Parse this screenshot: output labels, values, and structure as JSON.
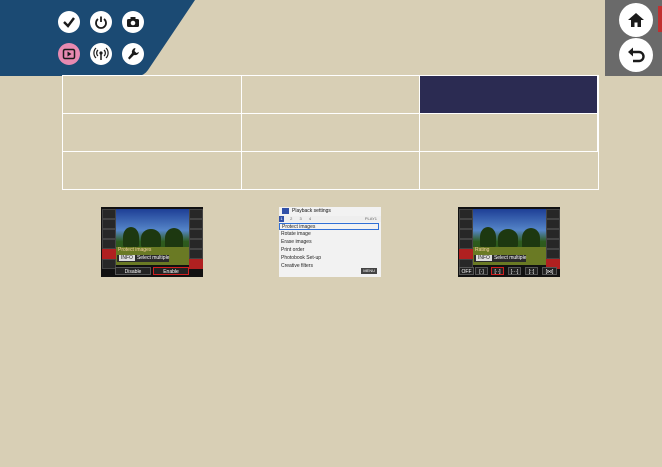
{
  "header": {
    "colors": {
      "band": "#1b4a73",
      "accent": "#e88ab1",
      "background": "#d8cfb5"
    },
    "left_icons": [
      {
        "name": "checkmark-icon",
        "active": false
      },
      {
        "name": "power-icon",
        "active": false
      },
      {
        "name": "camera-icon",
        "active": false
      },
      {
        "name": "playback-icon",
        "active": true
      },
      {
        "name": "wireless-icon",
        "active": false
      },
      {
        "name": "wrench-icon",
        "active": false
      }
    ],
    "right_buttons": [
      {
        "name": "home-icon"
      },
      {
        "name": "back-icon"
      }
    ]
  },
  "thumbnails": {
    "protect": {
      "label": "Protect images",
      "info_tag": "INFO",
      "info_text": "Select multiple",
      "buttons": [
        "Disable",
        "Enable"
      ],
      "selected_button": "Enable"
    },
    "menu": {
      "title": "Playback settings",
      "tab_numbers": [
        "1",
        "2",
        "3",
        "4"
      ],
      "tab_right": "PLAY1",
      "items": [
        "Protect images",
        "Rotate image",
        "Erase images",
        "Print order",
        "Photobook Set-up",
        "Creative filters"
      ],
      "selected_item": "Protect images",
      "footer": "MENU"
    },
    "rating": {
      "label": "Rating",
      "info_tag": "INFO",
      "info_text": "Select multiple",
      "buttons": [
        "OFF",
        "[·]",
        "[··]",
        "[···]",
        "[::]",
        "[⋈]"
      ],
      "selected_index": 2
    }
  }
}
